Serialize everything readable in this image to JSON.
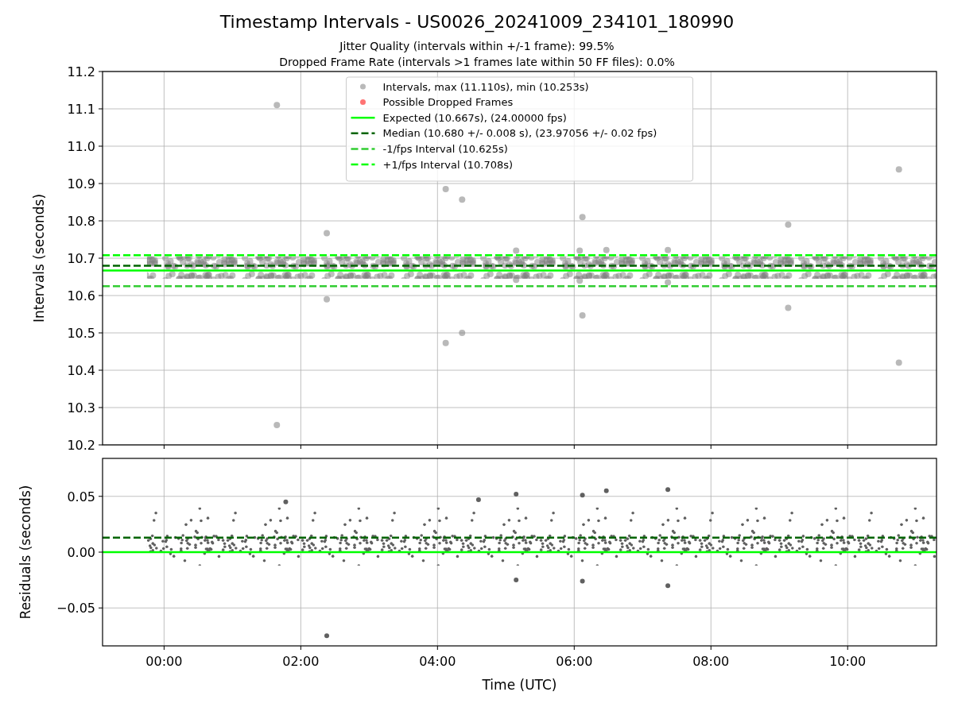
{
  "figure": {
    "title": "Timestamp Intervals - US0026_20241009_234101_180990",
    "subtitles": [
      "Jitter Quality (intervals within +/-1 frame): 99.5%",
      "Dropped Frame Rate (intervals >1 frames late within 50 FF files): 0.0%"
    ]
  },
  "intervals_plot": {
    "chart_data": {
      "type": "scatter",
      "ylabel": "Intervals (seconds)",
      "xlim": [
        -0.9,
        11.3
      ],
      "ylim": [
        10.2,
        11.2
      ],
      "yticks": [
        {
          "value": 10.2,
          "label": "10.2"
        },
        {
          "value": 10.3,
          "label": "10.3"
        },
        {
          "value": 10.4,
          "label": "10.4"
        },
        {
          "value": 10.5,
          "label": "10.5"
        },
        {
          "value": 10.6,
          "label": "10.6"
        },
        {
          "value": 10.7,
          "label": "10.7"
        },
        {
          "value": 10.8,
          "label": "10.8"
        },
        {
          "value": 10.9,
          "label": "10.9"
        },
        {
          "value": 11.0,
          "label": "11.0"
        },
        {
          "value": 11.1,
          "label": "11.1"
        },
        {
          "value": 11.2,
          "label": "11.2"
        }
      ],
      "series": [
        {
          "name": "Intervals, max (11.110s), min (10.253s)",
          "color": "#808080",
          "x": [
            1.65,
            1.65,
            2.38,
            2.38,
            4.12,
            4.36,
            4.12,
            4.36,
            5.15,
            5.15,
            6.08,
            6.08,
            6.12,
            6.12,
            6.47,
            7.37,
            7.37,
            9.13,
            9.13,
            10.75,
            10.75
          ],
          "values": [
            11.11,
            10.253,
            10.767,
            10.59,
            10.885,
            10.857,
            10.473,
            10.5,
            10.72,
            10.642,
            10.72,
            10.64,
            10.81,
            10.547,
            10.722,
            10.722,
            10.635,
            10.79,
            10.567,
            10.938,
            10.42
          ]
        },
        {
          "name": "Possible Dropped Frames",
          "color": "#ff0000"
        }
      ],
      "ref_lines": [
        {
          "axis": "y",
          "value": 10.667,
          "label": "Expected (10.667s), (24.00000 fps)",
          "color": "#00ff00"
        },
        {
          "axis": "y",
          "value": 10.68,
          "label": "Median (10.680 +/- 0.008 s), (23.97056 +/- 0.02 fps)",
          "color": "#006400"
        },
        {
          "axis": "y",
          "value": 10.625,
          "label": "-1/fps Interval (10.625s)",
          "color": "#32cd32"
        },
        {
          "axis": "y",
          "value": 10.708,
          "label": "+1/fps Interval (10.708s)",
          "color": "#00ff00"
        }
      ],
      "bands": [
        {
          "axis": "y",
          "from": 10.645,
          "to": 10.705,
          "color": "#808080"
        }
      ],
      "grid": true,
      "legend": true
    }
  },
  "residuals_plot": {
    "chart_data": {
      "type": "scatter",
      "xlabel": "Time (UTC)",
      "ylabel": "Residuals (seconds)",
      "xlim": [
        -0.9,
        11.3
      ],
      "ylim": [
        -0.084,
        0.084
      ],
      "xticks": [
        {
          "value": 0,
          "label": "00:00"
        },
        {
          "value": 2,
          "label": "02:00"
        },
        {
          "value": 4,
          "label": "04:00"
        },
        {
          "value": 6,
          "label": "06:00"
        },
        {
          "value": 8,
          "label": "08:00"
        },
        {
          "value": 10,
          "label": "10:00"
        }
      ],
      "yticks": [
        {
          "value": -0.05,
          "label": "−0.05"
        },
        {
          "value": 0,
          "label": "0.00"
        },
        {
          "value": 0.05,
          "label": "0.05"
        }
      ],
      "series": [
        {
          "color": "#606060",
          "x": [
            2.38,
            7.37,
            7.37,
            5.15,
            6.12,
            6.47,
            4.6,
            1.78,
            5.15,
            6.12
          ],
          "values": [
            -0.075,
            0.056,
            -0.03,
            0.052,
            0.051,
            0.055,
            0.047,
            0.045,
            -0.025,
            -0.026
          ]
        }
      ],
      "ref_lines": [
        {
          "axis": "y",
          "value": 0,
          "color": "#00ff00"
        },
        {
          "axis": "y",
          "value": 0.013,
          "color": "#006400"
        }
      ],
      "bands": [
        {
          "axis": "y",
          "from": -0.012,
          "to": 0.04,
          "color": "#606060"
        }
      ],
      "grid": true
    }
  }
}
